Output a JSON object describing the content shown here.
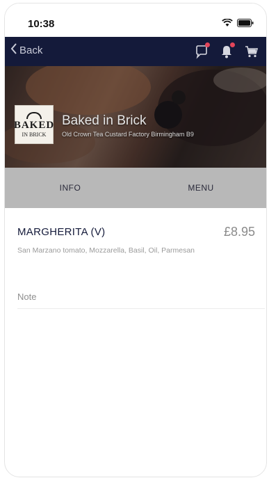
{
  "status_bar": {
    "time": "10:38"
  },
  "nav": {
    "back_label": "Back"
  },
  "restaurant": {
    "name": "Baked in Brick",
    "address": "Old Crown Tea Custard Factory Birmingham B9",
    "logo_main": "BAKED",
    "logo_sub": "IN BRICK"
  },
  "tabs": [
    {
      "label": "INFO"
    },
    {
      "label": "MENU"
    }
  ],
  "item": {
    "name": "MARGHERITA (V)",
    "price": "£8.95",
    "description": "San Marzano tomato, Mozzarella, Basil, Oil, Parmesan",
    "note_placeholder": "Note"
  },
  "colors": {
    "nav_background": "#141a3a",
    "tab_background": "#b8b8b8",
    "badge": "#e4455a"
  },
  "icons": [
    "wifi-icon",
    "battery-icon",
    "chevron-left-icon",
    "chat-icon",
    "bell-icon",
    "cart-icon"
  ]
}
